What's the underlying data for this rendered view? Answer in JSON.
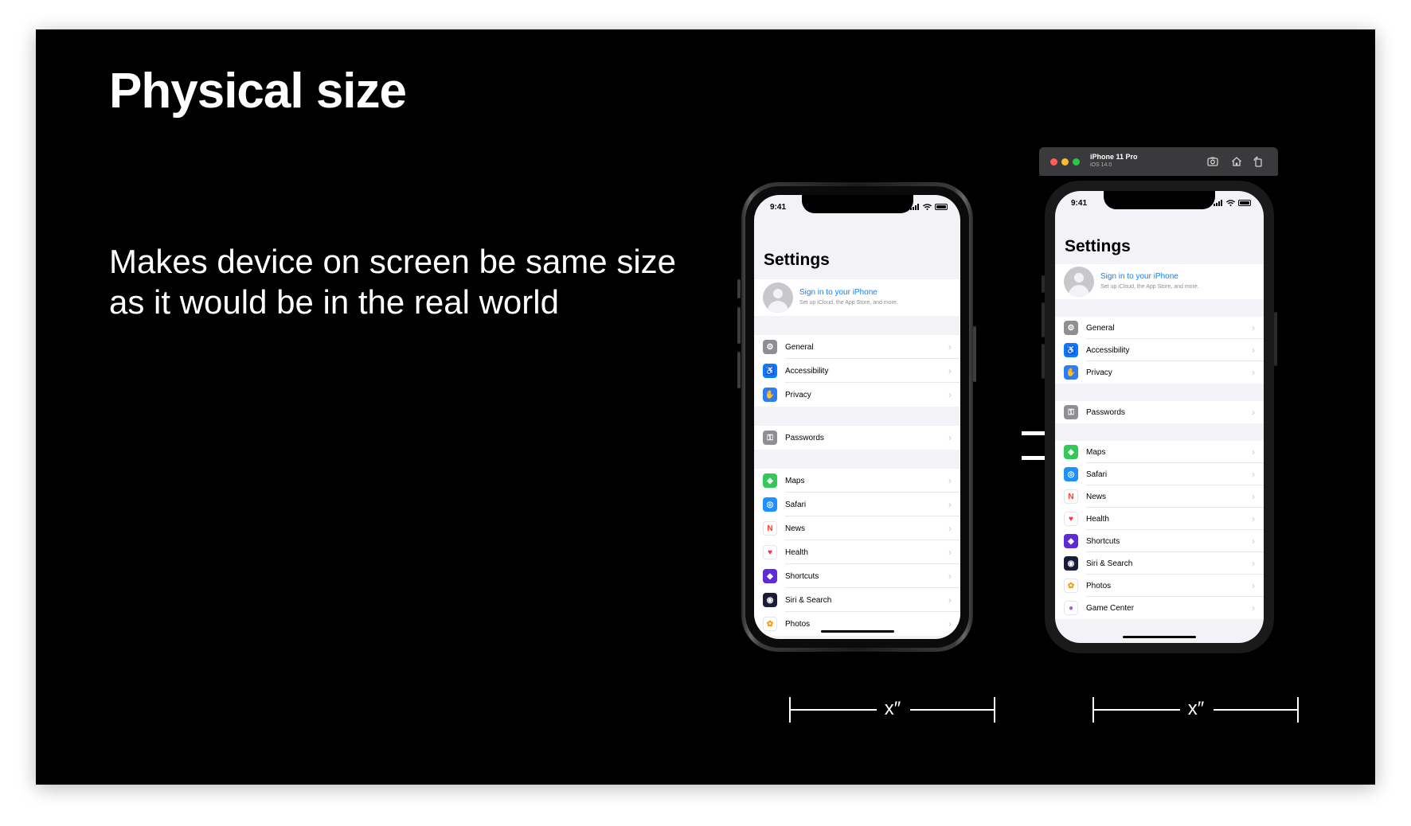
{
  "slide": {
    "title": "Physical size",
    "body_line1": "Makes device on screen be same size",
    "body_line2": "as it would be in the real world",
    "equals_sign": "=",
    "dimension_label": "x″"
  },
  "simulator": {
    "device_name": "iPhone 11 Pro",
    "os_version": "iOS 14.0",
    "toolbar_icons": [
      "screenshot-icon",
      "home-icon",
      "rotate-icon"
    ],
    "traffic_lights": [
      "#ff5f57",
      "#febc2e",
      "#28c840"
    ]
  },
  "phone_screen": {
    "time": "9:41",
    "title": "Settings",
    "sign_in": "Sign in to your iPhone",
    "sign_in_sub": "Set up iCloud, the App Store, and more.",
    "chevron": "›",
    "groups": [
      [
        {
          "label": "General",
          "icon": "gear-icon",
          "color": "#8e8e93",
          "glyph": "⚙"
        },
        {
          "label": "Accessibility",
          "icon": "accessibility-icon",
          "color": "#0a7aff",
          "glyph": "♿"
        },
        {
          "label": "Privacy",
          "icon": "hand-icon",
          "color": "#2f7cf6",
          "glyph": "✋"
        }
      ],
      [
        {
          "label": "Passwords",
          "icon": "key-icon",
          "color": "#8e8e93",
          "glyph": "⚿"
        }
      ],
      [
        {
          "label": "Maps",
          "icon": "maps-icon",
          "color": "#34c759",
          "glyph": "◈"
        },
        {
          "label": "Safari",
          "icon": "safari-icon",
          "color": "#1e90ff",
          "glyph": "◎"
        },
        {
          "label": "News",
          "icon": "news-icon",
          "color": "#ffffff",
          "glyph": "N",
          "fg": "#ff3b30"
        },
        {
          "label": "Health",
          "icon": "health-icon",
          "color": "#ffffff",
          "glyph": "♥",
          "fg": "#ff2d55"
        },
        {
          "label": "Shortcuts",
          "icon": "shortcuts-icon",
          "color": "#5e2bd6",
          "glyph": "◆"
        },
        {
          "label": "Siri & Search",
          "icon": "siri-icon",
          "color": "#1c1c3a",
          "glyph": "◉"
        },
        {
          "label": "Photos",
          "icon": "photos-icon",
          "color": "#ffffff",
          "glyph": "✿",
          "fg": "#ff9500"
        },
        {
          "label": "Game Center",
          "icon": "game-center-icon",
          "color": "#ffffff",
          "glyph": "●",
          "fg": "#af52de"
        }
      ]
    ]
  }
}
